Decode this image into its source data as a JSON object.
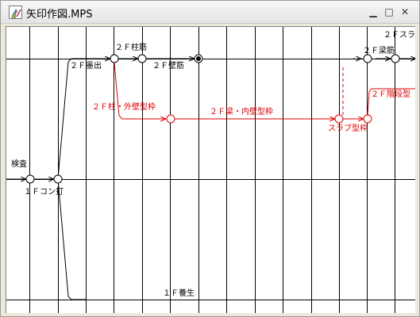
{
  "window": {
    "title": "矢印作図.MPS",
    "controls": {
      "minimize": "▁",
      "maximize": "□",
      "close": "✕"
    }
  },
  "colors": {
    "black": "#000000",
    "red": "#e00000",
    "grid": "#000000"
  },
  "diagram": {
    "labels": {
      "top_right": "２Ｆスラ",
      "col_2f": "２Ｆ柱筋",
      "beam_2f": "２Ｆ梁筋",
      "ceiling_2f": "２Ｆ墨出",
      "wall_2f": "２Ｆ壁筋",
      "outer_formwork": "２Ｆ柱・外壁型枠",
      "inner_formwork": "２Ｆ梁・内壁型枠",
      "slab_formwork": "スラブ型枠",
      "stairs_formwork": "２Ｆ階段型",
      "inspection": "検査",
      "concrete_1f": "１Ｆコン打",
      "curing_1f": "１Ｆ養生"
    }
  }
}
